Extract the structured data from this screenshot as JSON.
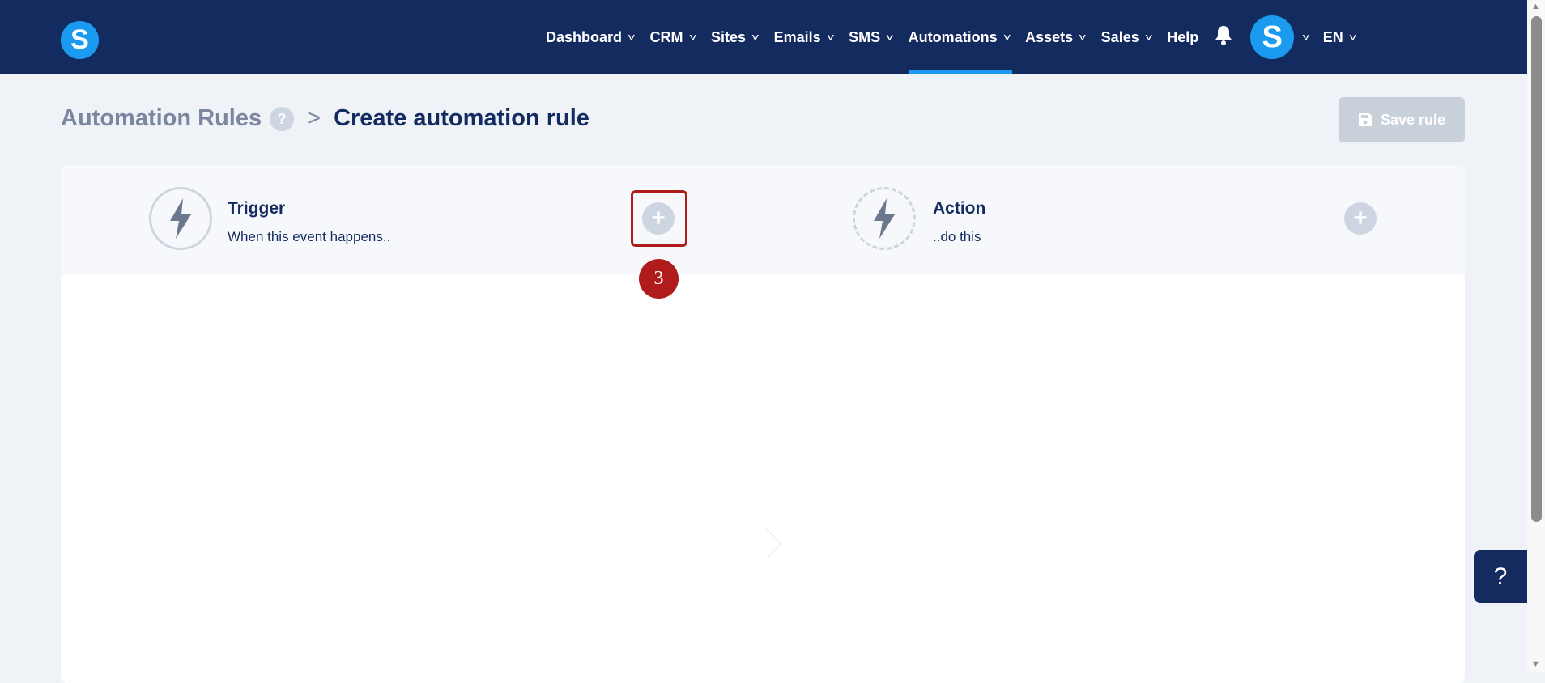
{
  "nav": {
    "logo": "S",
    "items": [
      {
        "label": "Dashboard",
        "chevron": true
      },
      {
        "label": "CRM",
        "chevron": true
      },
      {
        "label": "Sites",
        "chevron": true
      },
      {
        "label": "Emails",
        "chevron": true
      },
      {
        "label": "SMS",
        "chevron": true
      },
      {
        "label": "Automations",
        "chevron": true,
        "active": true
      },
      {
        "label": "Assets",
        "chevron": true
      },
      {
        "label": "Sales",
        "chevron": true
      },
      {
        "label": "Help",
        "chevron": false
      }
    ],
    "avatar": "S",
    "language": "EN"
  },
  "breadcrumb": {
    "root": "Automation Rules",
    "help": "?",
    "separator": ">",
    "current": "Create automation rule"
  },
  "save_label": "Save rule",
  "trigger": {
    "title": "Trigger",
    "subtitle": "When this event happens.."
  },
  "action": {
    "title": "Action",
    "subtitle": "..do this"
  },
  "step_badge": "3",
  "help_button": "?",
  "colors": {
    "navy": "#142b5f",
    "accent": "#1a9bf0"
  }
}
